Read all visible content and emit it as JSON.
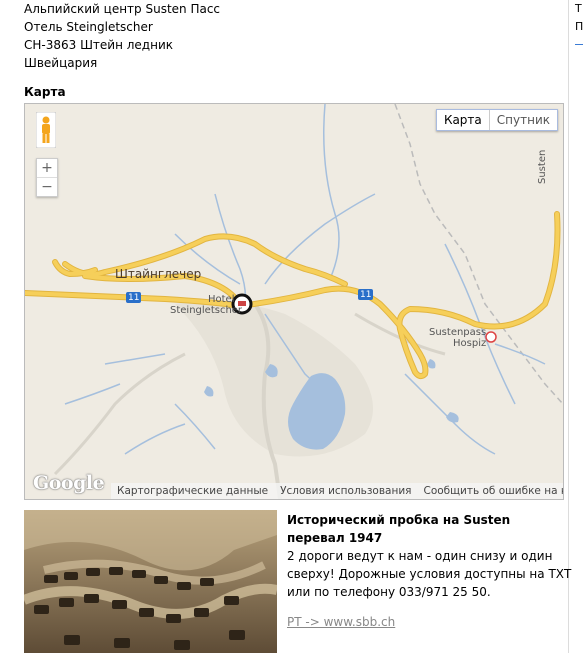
{
  "address": {
    "line1": "Альпийский центр Susten Пасс",
    "line2": "Отель Steingletscher",
    "line3": "CH-3863 Штейн ледник",
    "line4": "Швейцария"
  },
  "right_edge": {
    "t1": "Т",
    "t2": "По"
  },
  "map": {
    "heading": "Карта",
    "type_map": "Карта",
    "type_satellite": "Спутник",
    "zoom_in": "+",
    "zoom_out": "−",
    "labels": {
      "steingletscher_ru": "Штайнглечер",
      "hotel_l1": "Hotel",
      "hotel_l2": "Steingletscher",
      "sustenpass_l1": "Sustenpass",
      "sustenpass_l2": "Hospiz",
      "susten_vertical": "Susten",
      "road_11_a": "11",
      "road_11_b": "11"
    },
    "logo": "Google",
    "footer": {
      "data": "Картографические данные",
      "terms": "Условия использования",
      "report": "Сообщить об ошибке на карте"
    },
    "colors": {
      "road": "#f6cf5a",
      "water": "#a5bfdd",
      "land": "#efebe2"
    }
  },
  "info": {
    "title": "Исторический пробка на Susten перевал 1947",
    "body": "2 дороги ведут к нам - один снизу и один сверху! Дорожные условия доступны на ТХТ или по телефону 033/971 25 50.",
    "link": "PT -> www.sbb.ch"
  }
}
